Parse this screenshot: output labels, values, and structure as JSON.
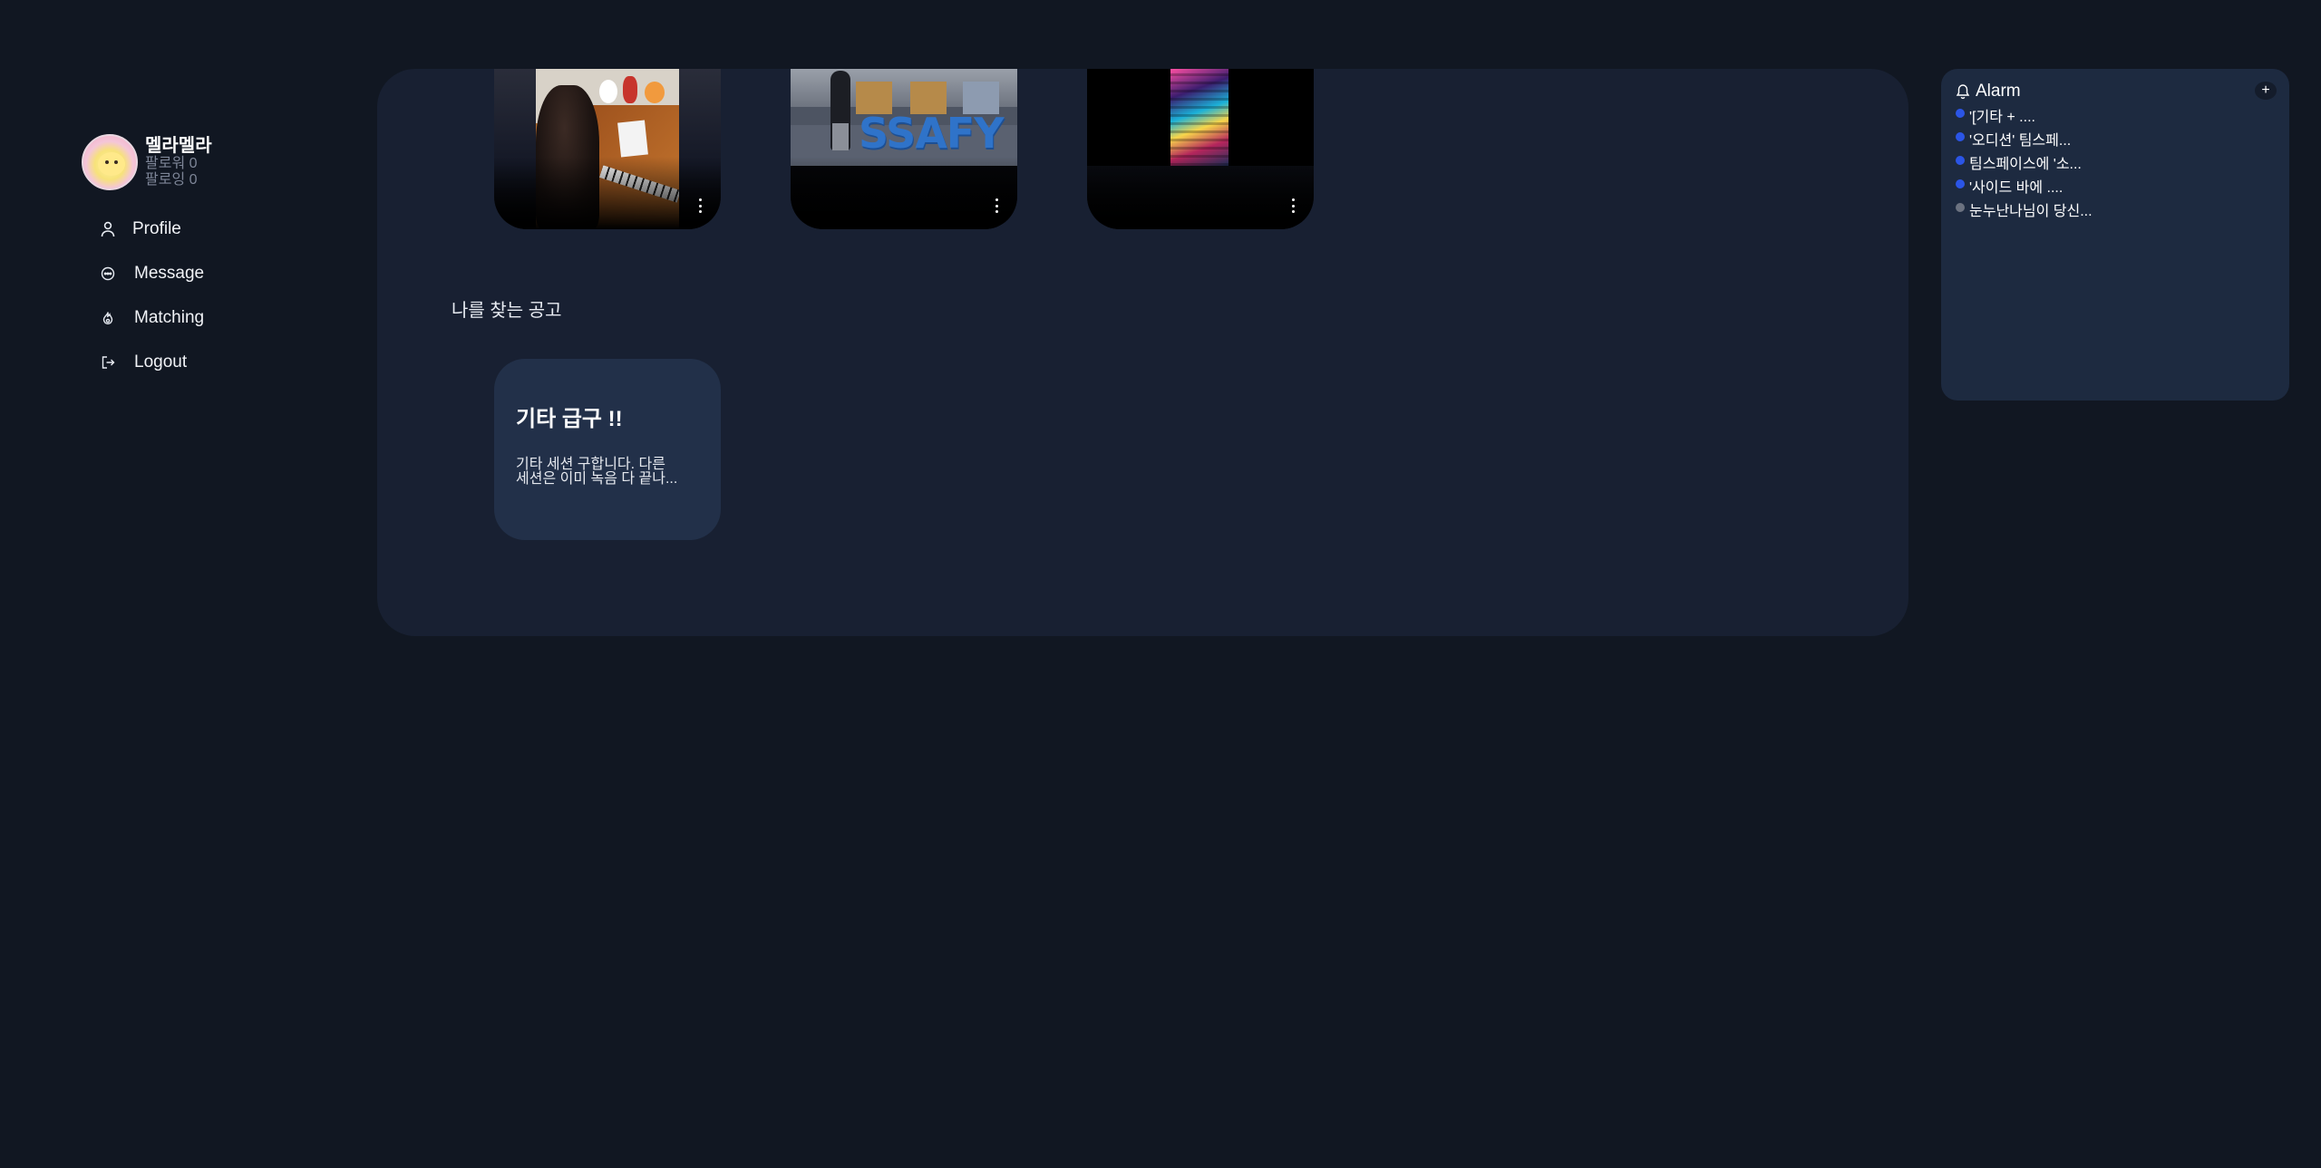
{
  "sidebar": {
    "username": "멜라멜라",
    "followers": "팔로워 0",
    "following": "팔로잉 0",
    "nav": [
      {
        "label": "Profile",
        "icon": "user-icon"
      },
      {
        "label": "Message",
        "icon": "message-icon"
      },
      {
        "label": "Matching",
        "icon": "fire-icon"
      },
      {
        "label": "Logout",
        "icon": "logout-icon"
      }
    ]
  },
  "main": {
    "videos": [
      {
        "thumbnail": "piano-video-thumbnail",
        "menu_icon": "more-vertical-icon"
      },
      {
        "thumbnail": "ssafy-video-thumbnail",
        "menu_icon": "more-vertical-icon"
      },
      {
        "thumbnail": "neon-video-thumbnail",
        "menu_icon": "more-vertical-icon"
      }
    ],
    "section_title": "나를 찾는 공고",
    "post": {
      "title": "기타 급구 !!",
      "body_line1": "기타 세션 구합니다. 다른",
      "body_line2": "세션은 이미 녹음 다 끝나..."
    }
  },
  "alarm": {
    "title": "Alarm",
    "add_label": "+",
    "items": [
      {
        "text": "'[기타 + ....",
        "status_color": "#2b55e6"
      },
      {
        "text": "'오디션' 팀스페...",
        "status_color": "#2b55e6"
      },
      {
        "text": "팀스페이스에 '소...",
        "status_color": "#2b55e6"
      },
      {
        "text": "'사이드 바에 ....",
        "status_color": "#2b55e6"
      },
      {
        "text": "눈누난나님이 당신...",
        "status_color": "#6b7280"
      }
    ]
  },
  "colors": {
    "background": "#111722",
    "panel": "#182032",
    "card": "#223049",
    "alarm_panel": "#1d2a40",
    "unread_dot": "#2b55e6",
    "read_dot": "#6b7280"
  }
}
